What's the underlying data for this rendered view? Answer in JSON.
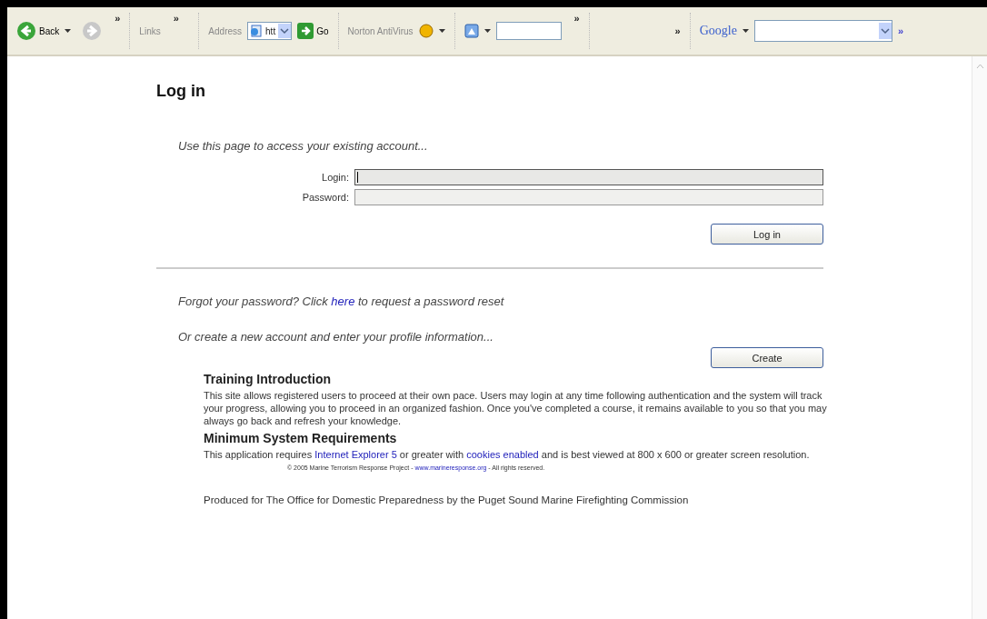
{
  "toolbar": {
    "back": "Back",
    "links": "Links",
    "address_label": "Address",
    "address_value": "htt",
    "go": "Go",
    "antivirus": "Norton AntiVirus",
    "google": "Google",
    "chevron": "»"
  },
  "page": {
    "title": "Log in",
    "intro": "Use this page to access your existing account...",
    "fields": [
      {
        "label": "Login:",
        "focused": true
      },
      {
        "label": "Password:",
        "focused": false
      }
    ],
    "login_button": "Log in",
    "forgot": [
      {
        "kind": "text",
        "text": "Forgot your password? Click "
      },
      {
        "kind": "link",
        "text": "here"
      },
      {
        "kind": "text",
        "text": " to request a password reset"
      }
    ],
    "create_prompt": "Or create a new account and enter your profile information...",
    "create_button": "Create",
    "sections": [
      {
        "heading": "Training Introduction",
        "body": [
          {
            "kind": "text",
            "text": "This site allows registered users to proceed at their own pace. Users may login at any time following authentication and the system will track your progress, allowing you to proceed in an organized fashion. Once you've completed a course, it remains available to you so that you may always go back and refresh your knowledge."
          }
        ]
      },
      {
        "heading": "Minimum System Requirements",
        "body": [
          {
            "kind": "text",
            "text": "This application requires "
          },
          {
            "kind": "link",
            "text": "Internet Explorer 5"
          },
          {
            "kind": "text",
            "text": " or greater with "
          },
          {
            "kind": "link",
            "text": "cookies enabled"
          },
          {
            "kind": "text",
            "text": " and is best viewed at 800 x 600 or greater screen resolution."
          }
        ]
      }
    ],
    "copyright": [
      {
        "kind": "text",
        "text": "© 2005 Marine Terrorism Response Project - "
      },
      {
        "kind": "link",
        "text": "www.marineresponse.org"
      },
      {
        "kind": "text",
        "text": " - All rights reserved."
      }
    ],
    "produced": "Produced for The Office for Domestic Preparedness by the Puget Sound Marine Firefighting Commission"
  }
}
